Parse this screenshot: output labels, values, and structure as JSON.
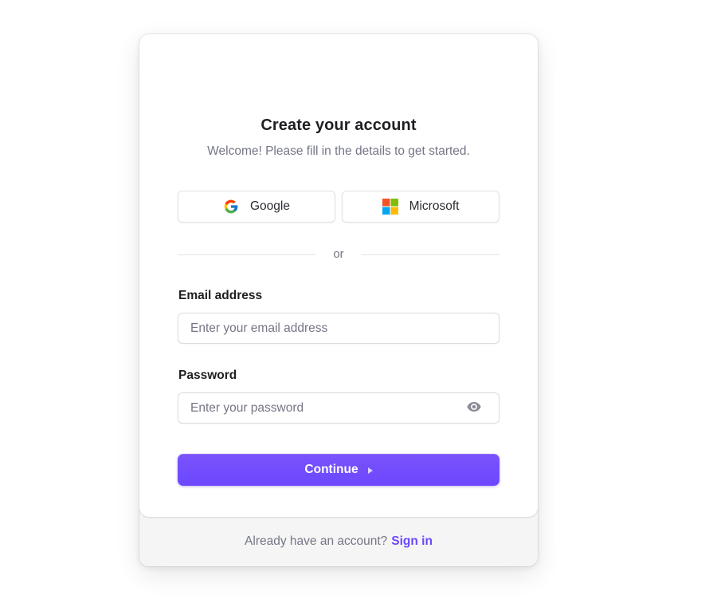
{
  "header": {
    "title": "Create your account",
    "subtitle": "Welcome! Please fill in the details to get started."
  },
  "social": {
    "google_label": "Google",
    "google_icon": "google-icon",
    "microsoft_label": "Microsoft",
    "microsoft_icon": "microsoft-icon"
  },
  "divider": {
    "text": "or"
  },
  "form": {
    "email": {
      "label": "Email address",
      "placeholder": "Enter your email address",
      "value": ""
    },
    "password": {
      "label": "Password",
      "placeholder": "Enter your password",
      "value": "",
      "toggle_icon": "eye-icon"
    },
    "continue_label": "Continue",
    "continue_icon": "play-arrow-icon"
  },
  "footer": {
    "prompt": "Already have an account?",
    "link": "Sign in"
  },
  "colors": {
    "accent": "#6c47ff",
    "muted_text": "#747686",
    "footer_bg": "#f5f5f5"
  }
}
